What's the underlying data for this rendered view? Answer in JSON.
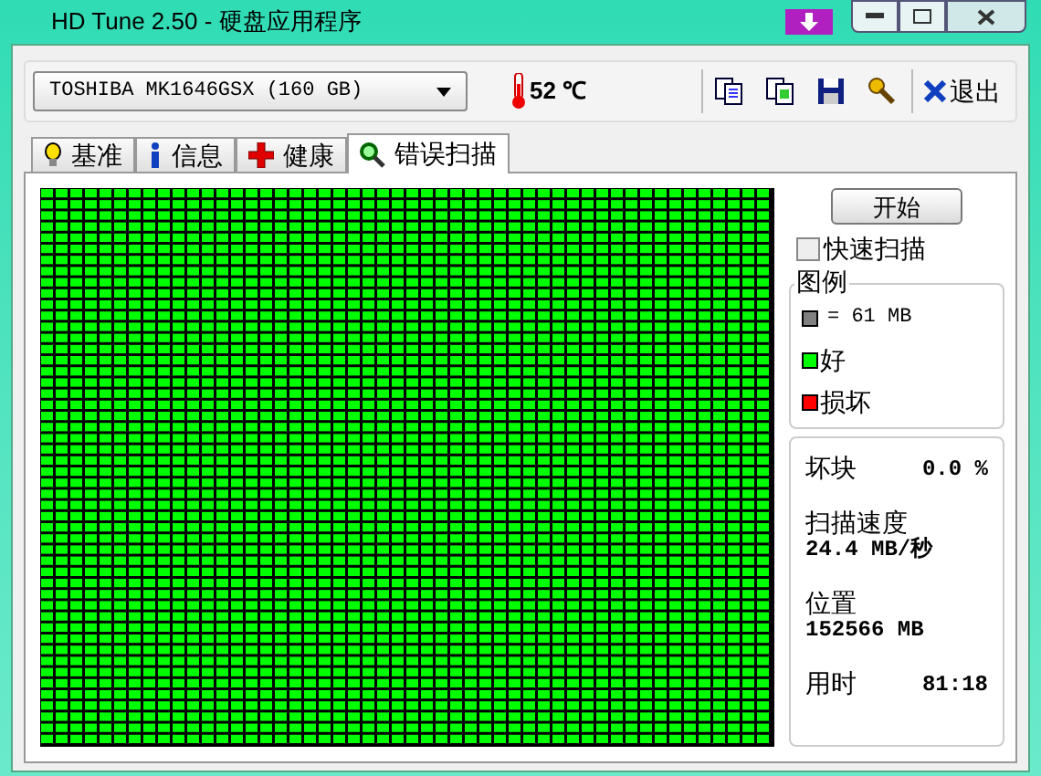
{
  "window": {
    "title": "HD Tune 2.50 - 硬盘应用程序"
  },
  "toolbar": {
    "drive": "TOSHIBA MK1646GSX (160 GB)",
    "temperature": "52 ℃",
    "exit": "退出"
  },
  "tabs": [
    {
      "label": "基准",
      "kind": "bulb",
      "selected": false
    },
    {
      "label": "信息",
      "kind": "info",
      "selected": false
    },
    {
      "label": "健康",
      "kind": "cross",
      "selected": false
    },
    {
      "label": "错误扫描",
      "kind": "search",
      "selected": true
    }
  ],
  "start_button": "开始",
  "quick_scan": {
    "label": "快速扫描",
    "checked": false
  },
  "legend": {
    "title": "图例",
    "items": [
      {
        "label": "= 61 MB",
        "color": "#808080"
      },
      {
        "label": "好",
        "color": "#00ff00"
      },
      {
        "label": "损坏",
        "color": "#ff0000"
      }
    ]
  },
  "stats": [
    {
      "label": "坏块",
      "value": "0.0 %"
    },
    {
      "label": "扫描速度",
      "value": "24.4 MB/秒"
    },
    {
      "label": "位置",
      "value": "152566 MB"
    },
    {
      "label": "用时",
      "value": "81:18"
    }
  ]
}
